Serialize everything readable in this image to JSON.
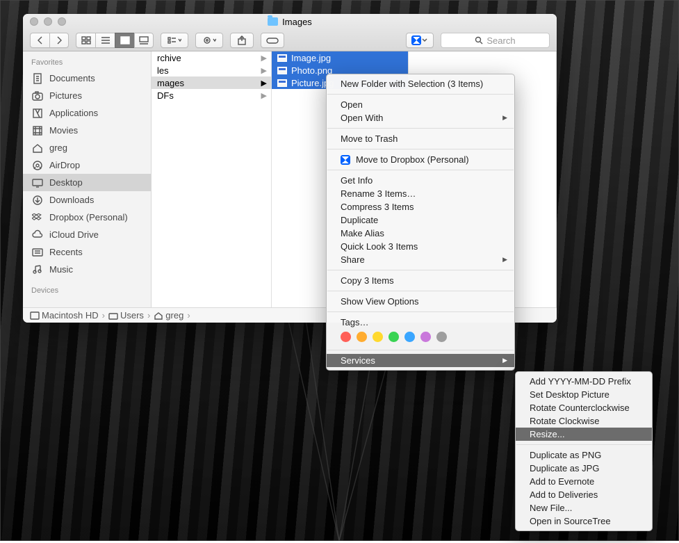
{
  "window_title": "Images",
  "search_placeholder": "Search",
  "sidebar": {
    "favorites_label": "Favorites",
    "devices_label": "Devices",
    "items": [
      {
        "icon": "doc",
        "label": "Documents"
      },
      {
        "icon": "camera",
        "label": "Pictures"
      },
      {
        "icon": "apps",
        "label": "Applications"
      },
      {
        "icon": "film",
        "label": "Movies"
      },
      {
        "icon": "home",
        "label": "greg"
      },
      {
        "icon": "airdrop",
        "label": "AirDrop"
      },
      {
        "icon": "desktop",
        "label": "Desktop"
      },
      {
        "icon": "download",
        "label": "Downloads"
      },
      {
        "icon": "dropbox",
        "label": "Dropbox (Personal)"
      },
      {
        "icon": "cloud",
        "label": "iCloud Drive"
      },
      {
        "icon": "recents",
        "label": "Recents"
      },
      {
        "icon": "music",
        "label": "Music"
      }
    ],
    "selected_index": 6
  },
  "col1": [
    {
      "label": "rchive"
    },
    {
      "label": "les"
    },
    {
      "label": "mages",
      "sel": true
    },
    {
      "label": "DFs"
    }
  ],
  "col2": [
    {
      "label": "Image.jpg"
    },
    {
      "label": "Photo.png"
    },
    {
      "label": "Picture.jpg"
    }
  ],
  "path": [
    "Macintosh HD",
    "Users",
    "greg"
  ],
  "ctx": [
    {
      "t": "item",
      "label": "New Folder with Selection (3 Items)"
    },
    {
      "t": "sep"
    },
    {
      "t": "item",
      "label": "Open"
    },
    {
      "t": "sub",
      "label": "Open With"
    },
    {
      "t": "sep"
    },
    {
      "t": "item",
      "label": "Move to Trash"
    },
    {
      "t": "sep"
    },
    {
      "t": "dropbox",
      "label": "Move to Dropbox (Personal)"
    },
    {
      "t": "sep"
    },
    {
      "t": "item",
      "label": "Get Info"
    },
    {
      "t": "item",
      "label": "Rename 3 Items…"
    },
    {
      "t": "item",
      "label": "Compress 3 Items"
    },
    {
      "t": "item",
      "label": "Duplicate"
    },
    {
      "t": "item",
      "label": "Make Alias"
    },
    {
      "t": "item",
      "label": "Quick Look 3 Items"
    },
    {
      "t": "sub",
      "label": "Share"
    },
    {
      "t": "sep"
    },
    {
      "t": "item",
      "label": "Copy 3 Items"
    },
    {
      "t": "sep"
    },
    {
      "t": "item",
      "label": "Show View Options"
    },
    {
      "t": "sep"
    },
    {
      "t": "item",
      "label": "Tags…"
    },
    {
      "t": "tags"
    },
    {
      "t": "sep"
    },
    {
      "t": "sub",
      "label": "Services",
      "sel": true
    }
  ],
  "tag_colors": [
    "#ff5f57",
    "#ffac30",
    "#ffd92e",
    "#39d353",
    "#3aa6ff",
    "#c978db",
    "#9e9e9e"
  ],
  "services": [
    {
      "label": "Add YYYY-MM-DD Prefix"
    },
    {
      "label": "Set Desktop Picture"
    },
    {
      "label": "Rotate Counterclockwise"
    },
    {
      "label": "Rotate Clockwise"
    },
    {
      "label": "Resize...",
      "sel": true
    },
    {
      "label": "sep"
    },
    {
      "label": "Duplicate as PNG"
    },
    {
      "label": "Duplicate as JPG"
    },
    {
      "label": "Add to Evernote"
    },
    {
      "label": "Add to Deliveries"
    },
    {
      "label": "New File..."
    },
    {
      "label": "Open in SourceTree"
    }
  ]
}
